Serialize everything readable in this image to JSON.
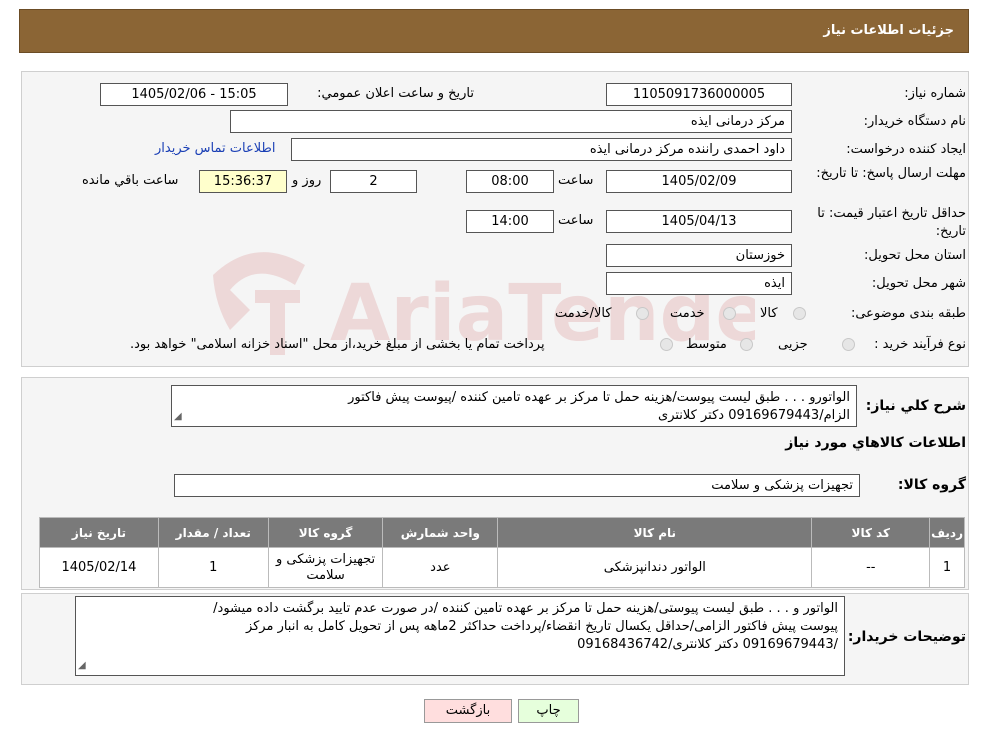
{
  "header": {
    "title": "جزئیات اطلاعات نیاز"
  },
  "watermark": {
    "text": "AriaTender.neT"
  },
  "form": {
    "need_number_label": "شماره نیاز:",
    "need_number": "1105091736000005",
    "announce_label": "تاريخ و ساعت اعلان عمومي:",
    "announce_value": "1405/02/06 - 15:05",
    "buyer_org_label": "نام دستگاه خریدار:",
    "buyer_org": "مرکز درمانی ایذه",
    "creator_label": "ایجاد کننده درخواست:",
    "creator": "داود احمدی راننده مرکز درمانی ایذه",
    "contact_link": "اطلاعات تماس خریدار",
    "deadline_label": "مهلت ارسال پاسخ: تا تاریخ:",
    "deadline_date": "1405/02/09",
    "time_label": "ساعت",
    "deadline_time": "08:00",
    "days_value": "2",
    "days_label": "روز و",
    "remaining_time": "15:36:37",
    "remaining_label": "ساعت باقي مانده",
    "validity_label": "حداقل تاریخ اعتبار قیمت: تا تاریخ:",
    "validity_date": "1405/04/13",
    "validity_time": "14:00",
    "province_label": "استان محل تحویل:",
    "province": "خوزستان",
    "city_label": "شهر محل تحویل:",
    "city": "ایذه",
    "category_label": "طبقه بندی موضوعی:",
    "category_options": [
      "کالا",
      "خدمت",
      "کالا/خدمت"
    ],
    "process_label": "نوع فرآیند خرید :",
    "process_options": [
      "جزیی",
      "متوسط"
    ],
    "process_note": "پرداخت تمام یا بخشی از مبلغ خرید،از محل \"اسناد خزانه اسلامی\" خواهد بود."
  },
  "description": {
    "label": "شرح کلي نياز:",
    "line1": "الواتورو . . . طبق لیست پیوست/هزینه حمل تا مرکز بر عهده تامین کننده /پیوست پیش فاکتور",
    "line2": "الزام/09169679443 دکتر کلانتری"
  },
  "goods_section": {
    "title": "اطلاعات کالاهاي مورد نياز",
    "group_label": "گروه کالا:",
    "group_value": "تجهیزات پزشکی و سلامت"
  },
  "table": {
    "headers": [
      "رديف",
      "کد کالا",
      "نام کالا",
      "واحد شمارش",
      "گروه کالا",
      "تعداد / مقدار",
      "تاريخ نياز"
    ],
    "rows": [
      {
        "row": "1",
        "code": "--",
        "name": "الواتور دندانپزشکی",
        "unit": "عدد",
        "group": "تجهیزات پزشکی و سلامت",
        "qty": "1",
        "date": "1405/02/14"
      }
    ]
  },
  "buyer_notes": {
    "label": "توضیحات خریدار:",
    "line1": "الواتور و . . . طبق  لیست پیوستی/هزینه حمل تا مرکز بر عهده تامین کننده /در صورت عدم تایید برگشت داده میشود/",
    "line2": "پیوست پیش فاکتور الزامی/حداقل یکسال تاریخ انقضاء/پرداخت حداکثر 2ماهه پس از تحویل کامل به انبار مرکز",
    "line3": "/09169679443 دکتر کلانتری/09168436742"
  },
  "buttons": {
    "print": "چاپ",
    "back": "بازگشت"
  },
  "colors": {
    "header": "#8b6535",
    "table_header": "#7a7a7a",
    "remaining_bg": "#ffffcc",
    "back_btn": "#ffdede",
    "print_btn": "#e6ffdc"
  }
}
